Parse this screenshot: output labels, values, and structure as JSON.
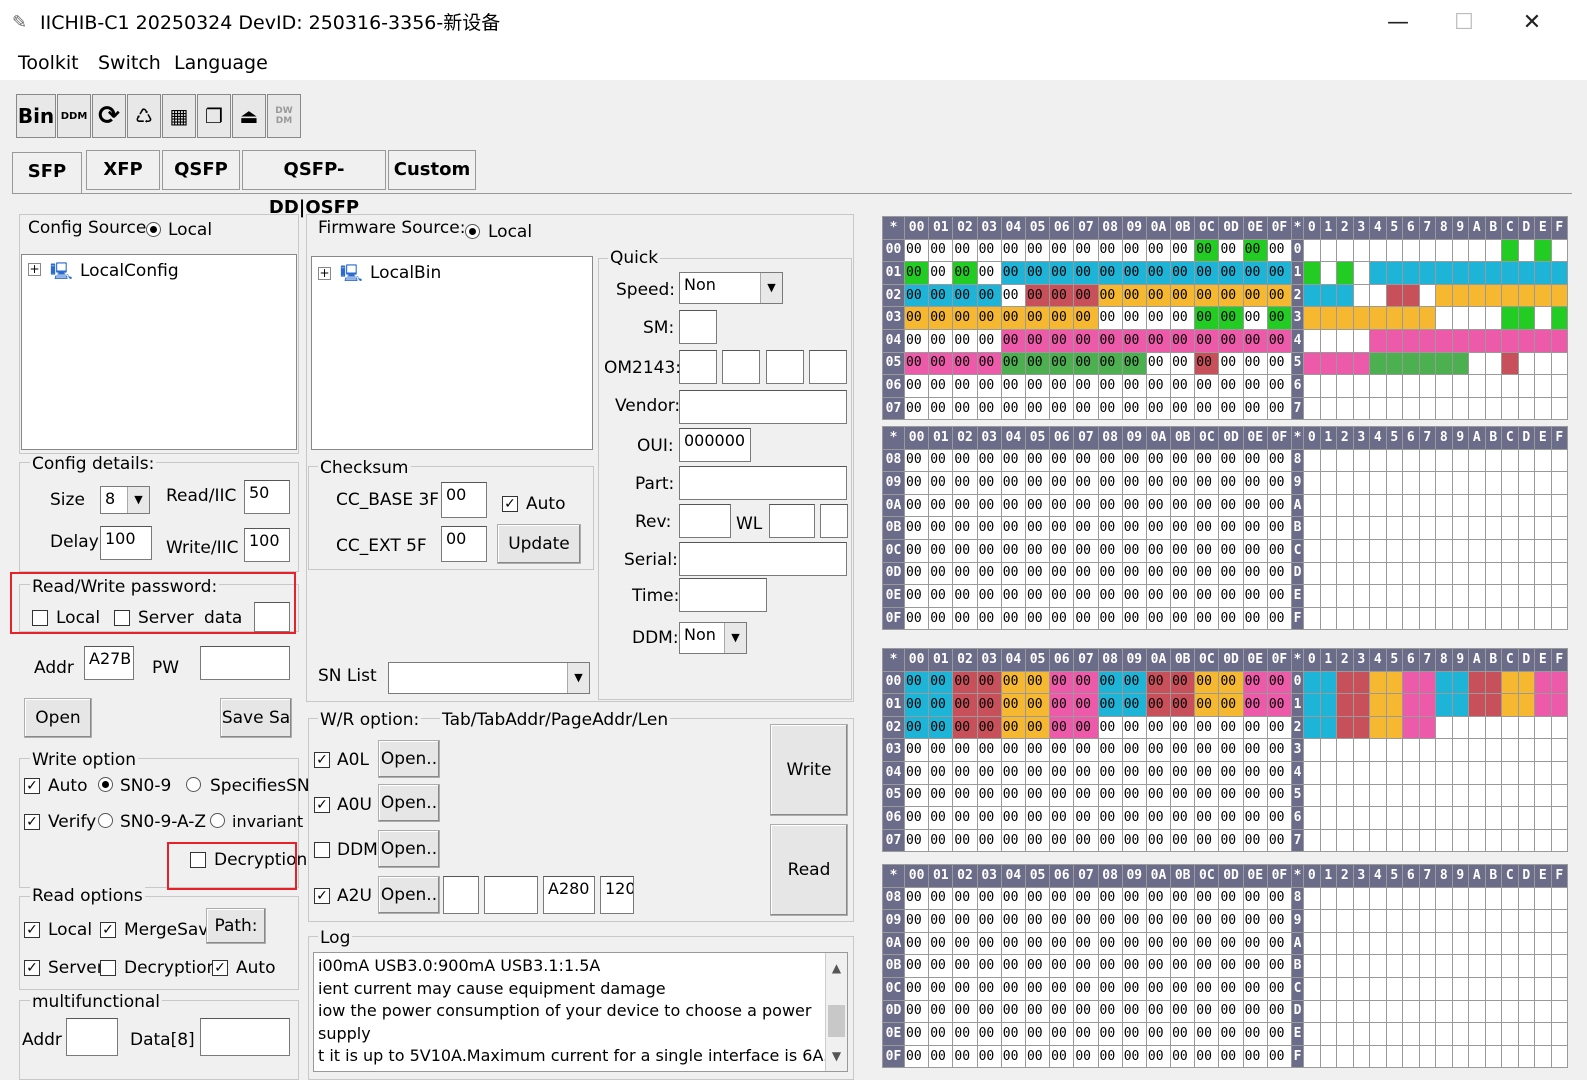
{
  "window": {
    "title": "IICHIB-C1 20250324 DevID: 250316-3356-新设备",
    "minimize": "—",
    "maximize": "☐",
    "close": "✕"
  },
  "menu": [
    "Toolkit",
    "Switch",
    "Language"
  ],
  "toolbar": {
    "bin": "Bin",
    "ddm": "DDM",
    "refresh": "⟳",
    "clean": "♺",
    "calc": "▦",
    "copy": "❐",
    "eject": "⏏",
    "dwdm": "DW DM"
  },
  "tabs": [
    "SFP",
    "XFP",
    "QSFP",
    "QSFP-DD|OSFP",
    "Custom"
  ],
  "config": {
    "source_label": "Config Source:",
    "source_value": "Local",
    "tree_item": "LocalConfig",
    "details_title": "Config details:",
    "size_label": "Size",
    "size_value": "8",
    "read_iic_label": "Read/IIC",
    "read_iic_value": "50",
    "delay_label": "Delay",
    "delay_value": "100",
    "write_iic_label": "Write/IIC",
    "write_iic_value": "100",
    "rw_password_title": "Read/Write password:",
    "pw_local": "Local",
    "pw_server": "Server",
    "pw_data": "data",
    "addr_label": "Addr",
    "addr_value": "A27B",
    "pw_label": "PW",
    "open_btn": "Open",
    "save_btn": "Save Sa",
    "write_option_title": "Write option",
    "auto": "Auto",
    "sn09": "SN0-9",
    "specifiessn": "SpecifiesSN",
    "verify": "Verify",
    "sn09az": "SN0-9-A-Z",
    "invariant": "invariant",
    "decryption": "Decryption",
    "read_options_title": "Read options",
    "ro_local": "Local",
    "ro_mergesave": "MergeSave",
    "ro_path": "Path:",
    "ro_server": "Server",
    "ro_decryption": "Decryption",
    "ro_auto": "Auto",
    "multi_title": "multifunctional",
    "multi_addr": "Addr",
    "multi_data": "Data[8]"
  },
  "firmware": {
    "source_label": "Firmware Source:",
    "source_value": "Local",
    "tree_item": "LocalBin",
    "checksum_title": "Checksum",
    "cc_base_label": "CC_BASE 3F",
    "cc_base_value": "00",
    "cc_ext_label": "CC_EXT  5F",
    "cc_ext_value": "00",
    "auto": "Auto",
    "update_btn": "Update",
    "snlist_label": "SN List"
  },
  "quick": {
    "title": "Quick",
    "speed_label": "Speed:",
    "speed_value": "Non",
    "sm_label": "SM:",
    "om_label": "OM2143:",
    "vendor_label": "Vendor:",
    "oui_label": "OUI:",
    "oui_value": "000000",
    "part_label": "Part:",
    "rev_label": "Rev:",
    "wl_label": "WL",
    "serial_label": "Serial:",
    "time_label": "Time:",
    "ddm_label": "DDM:",
    "ddm_value": "Non"
  },
  "wr": {
    "title": "W/R option:",
    "subtitle": "Tab/TabAddr/PageAddr/Len",
    "a0l": "A0L",
    "a0u": "A0U",
    "ddm": "DDM",
    "a2u": "A2U",
    "open": "Open..",
    "a2u_addr": "A280",
    "a2u_len": "120",
    "write_btn": "Write",
    "read_btn": "Read"
  },
  "log": {
    "title": "Log",
    "lines": [
      "i00mA USB3.0:900mA USB3.1:1.5A",
      "ient current may cause equipment damage",
      "iow the power consumption of your device to choose a power supply",
      "t it is up to 5V10A.Maximum current for a single interface is 6A."
    ]
  },
  "hex": {
    "corner": "*",
    "cols": [
      "00",
      "01",
      "02",
      "03",
      "04",
      "05",
      "06",
      "07",
      "08",
      "09",
      "0A",
      "0B",
      "0C",
      "0D",
      "0E",
      "0F"
    ],
    "ascii_cols": [
      "0",
      "1",
      "2",
      "3",
      "4",
      "5",
      "6",
      "7",
      "8",
      "9",
      "A",
      "B",
      "C",
      "D",
      "E",
      "F"
    ],
    "blocks": [
      {
        "rows": [
          "00",
          "01",
          "02",
          "03",
          "04",
          "05",
          "06",
          "07"
        ],
        "ascii": [
          "0",
          "1",
          "2",
          "3",
          "4",
          "5",
          "6",
          "7"
        ]
      },
      {
        "rows": [
          "08",
          "09",
          "0A",
          "0B",
          "0C",
          "0D",
          "0E",
          "0F"
        ],
        "ascii": [
          "8",
          "9",
          "A",
          "B",
          "C",
          "D",
          "E",
          "F"
        ]
      },
      {
        "rows": [
          "00",
          "01",
          "02",
          "03",
          "04",
          "05",
          "06",
          "07"
        ],
        "ascii": [
          "0",
          "1",
          "2",
          "3",
          "4",
          "5",
          "6",
          "7"
        ]
      },
      {
        "rows": [
          "08",
          "09",
          "0A",
          "0B",
          "0C",
          "0D",
          "0E",
          "0F"
        ],
        "ascii": [
          "8",
          "9",
          "A",
          "B",
          "C",
          "D",
          "E",
          "F"
        ]
      }
    ],
    "value": "00",
    "colors": {
      "green": "#22cc22",
      "cyan": "#1eb4d8",
      "orange": "#f5b830",
      "red": "#c8505a",
      "pink": "#ee5aaa",
      "dgreen": "#4caf50",
      "header": "#6b6b8a"
    }
  }
}
